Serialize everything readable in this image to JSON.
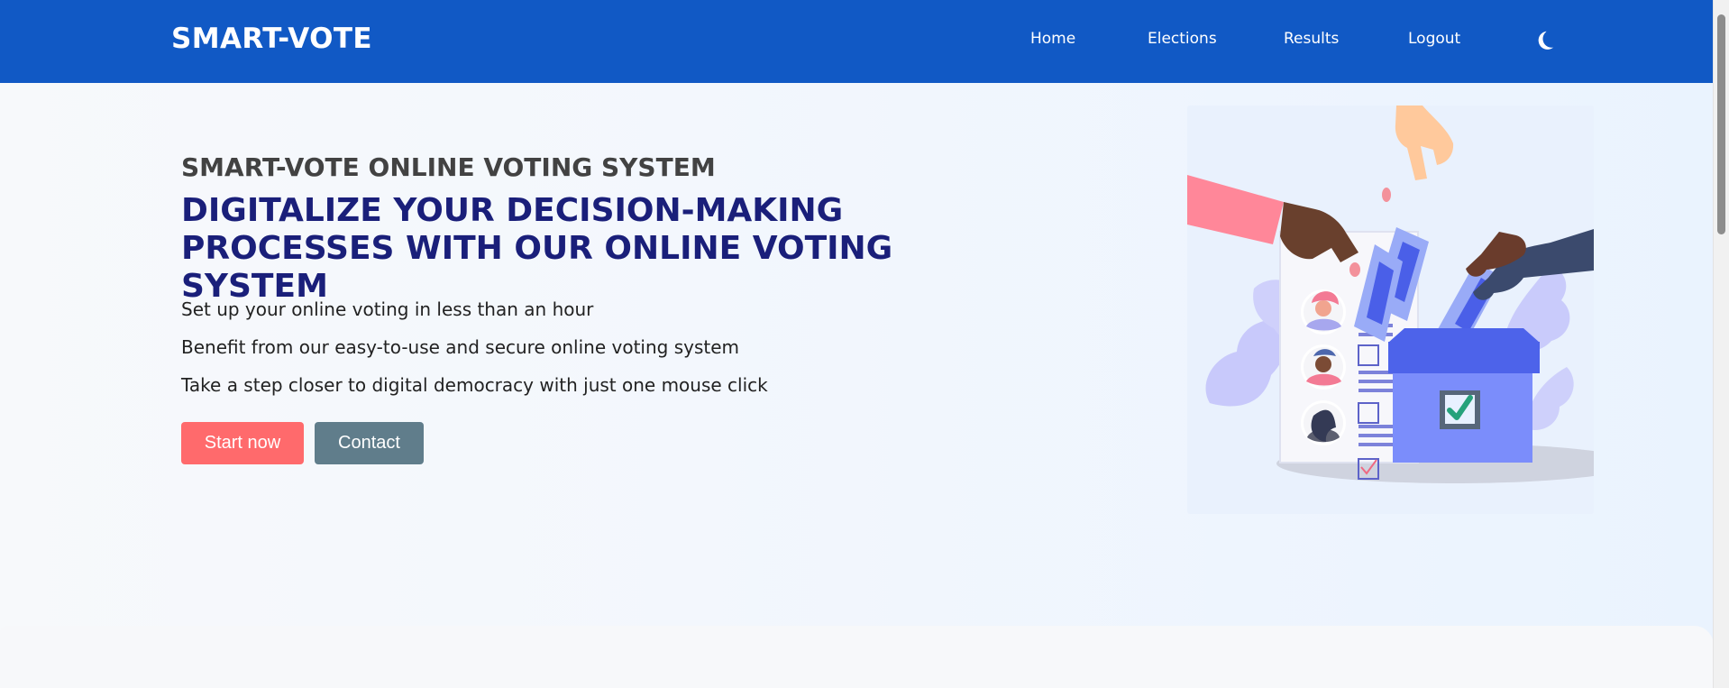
{
  "app": {
    "brand": "SMART-VOTE"
  },
  "nav": {
    "items": [
      {
        "label": "Home"
      },
      {
        "label": "Elections"
      },
      {
        "label": "Results"
      },
      {
        "label": "Logout"
      }
    ],
    "theme_icon": "moon-icon"
  },
  "hero": {
    "kicker": "SMART-VOTE ONLINE VOTING SYSTEM",
    "headline": "DIGITALIZE YOUR DECISION-MAKING\nPROCESSES WITH OUR ONLINE VOTING SYSTEM",
    "bullets": [
      "Set up your online voting in less than an hour",
      "Benefit from our easy-to-use and secure online voting system",
      "Take a step closer to digital democracy with just one mouse click"
    ],
    "buttons": {
      "start": "Start now",
      "contact": "Contact"
    },
    "illustration_icon": "ballot-box-voting-illustration"
  },
  "colors": {
    "nav_background": "#1159c5",
    "headline": "#1a1f7a",
    "start_button": "#ff6a6c",
    "contact_button": "#607d8b"
  }
}
